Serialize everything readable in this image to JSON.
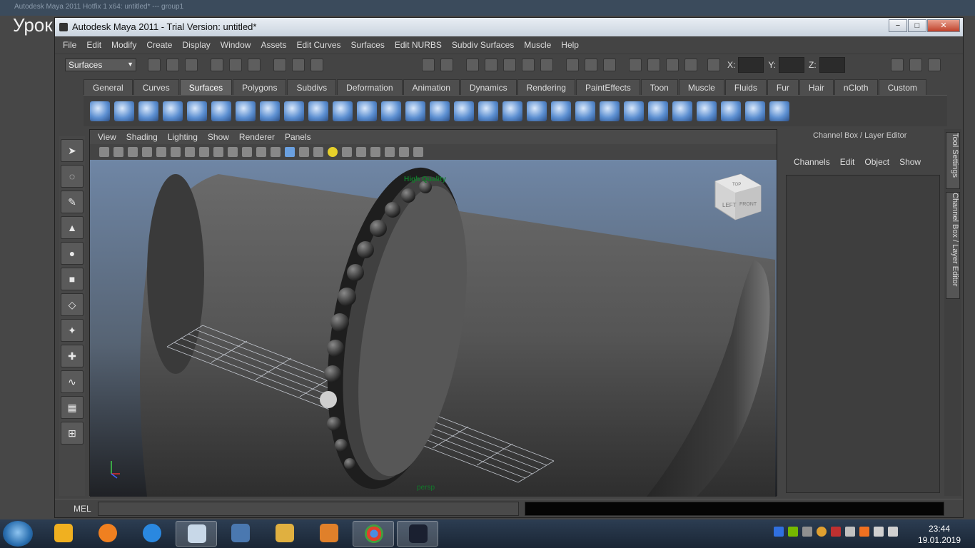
{
  "background": {
    "title": "Autodesk Maya 2011 Hotfix 1 x64: untitled*   ---   group1",
    "label": "Урок"
  },
  "window": {
    "title": "Autodesk Maya 2011 - Trial Version: untitled*",
    "minimize": "−",
    "maximize": "□",
    "close": "✕"
  },
  "menus": [
    "File",
    "Edit",
    "Modify",
    "Create",
    "Display",
    "Window",
    "Assets",
    "Edit Curves",
    "Surfaces",
    "Edit NURBS",
    "Subdiv Surfaces",
    "Muscle",
    "Help"
  ],
  "status": {
    "mode": "Surfaces",
    "x_label": "X:",
    "y_label": "Y:",
    "z_label": "Z:"
  },
  "shelf_tabs": [
    "General",
    "Curves",
    "Surfaces",
    "Polygons",
    "Subdivs",
    "Deformation",
    "Animation",
    "Dynamics",
    "Rendering",
    "PaintEffects",
    "Toon",
    "Muscle",
    "Fluids",
    "Fur",
    "Hair",
    "nCloth",
    "Custom"
  ],
  "active_shelf_tab": "Surfaces",
  "shelf_icons": [
    "nurbs-sphere-icon",
    "nurbs-cube-icon",
    "nurbs-cylinder-icon",
    "nurbs-cone-icon",
    "nurbs-plane-icon",
    "nurbs-torus-icon",
    "revolve-icon",
    "loft-icon",
    "planar-icon",
    "extrude-icon",
    "birail-icon",
    "boundary-icon",
    "square-icon",
    "bevel-icon",
    "bevel-plus-icon",
    "project-curve-icon",
    "intersect-icon",
    "trim-icon",
    "untrim-icon",
    "attach-icon",
    "detach-icon",
    "align-icon",
    "open-close-icon",
    "insert-isoparm-icon",
    "extend-icon",
    "offset-icon",
    "rebuild-icon",
    "sculpt-icon",
    "reverse-icon"
  ],
  "viewport": {
    "menus": [
      "View",
      "Shading",
      "Lighting",
      "Show",
      "Renderer",
      "Panels"
    ],
    "hq_label": "High Quality",
    "camera_label": "persp",
    "viewcube_left": "LEFT",
    "viewcube_front": "FRONT",
    "viewcube_top": "TOP"
  },
  "channel_box": {
    "header": "Channel Box / Layer Editor",
    "menus": [
      "Channels",
      "Edit",
      "Object",
      "Show"
    ]
  },
  "side_tabs": [
    "Tool Settings",
    "Channel Box / Layer Editor"
  ],
  "mel": {
    "label": "MEL"
  },
  "taskbar": {
    "time": "23:44",
    "date": "19.01.2019"
  },
  "colors": {
    "accent": "#5c8fd1",
    "viewport_top": "#6f86a5",
    "viewport_bottom": "#1f2125"
  }
}
